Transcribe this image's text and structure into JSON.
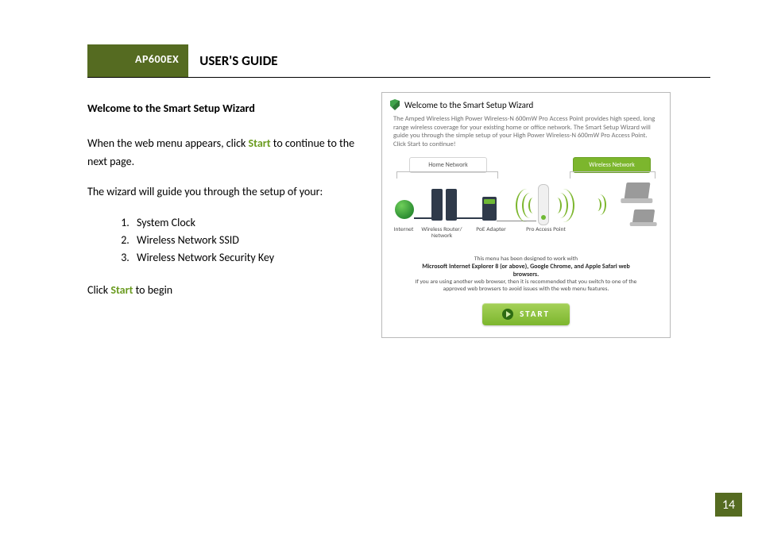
{
  "header": {
    "model": "AP600EX",
    "guide_title": "USER'S GUIDE"
  },
  "left": {
    "subhead": "Welcome to the Smart Setup Wizard",
    "para1_a": "When the web menu appears, click ",
    "para1_start": "Start",
    "para1_b": " to continue to the next page.",
    "para2": "The wizard will guide you through the setup of your:",
    "list": [
      "System Clock",
      "Wireless Network SSID",
      "Wireless Network Security Key"
    ],
    "closing_a": "Click ",
    "closing_start": "Start",
    "closing_b": " to begin"
  },
  "shot": {
    "title": "Welcome to the Smart Setup Wizard",
    "desc": "The Amped Wireless High Power Wireless-N 600mW Pro Access Point provides high speed, long range wireless coverage for your existing home or office network. The Smart Setup Wizard will guide you through the simple setup of your High Power Wireless-N 600mW Pro Access Point. Click Start to continue!",
    "labels": {
      "home_network": "Home Network",
      "wireless_network": "Wireless Network",
      "internet": "Internet",
      "router": "Wireless Router/\nNetwork",
      "poe": "PoE\nAdapter",
      "ap": "Pro Access Point"
    },
    "note_line1": "This menu has been designed to work with",
    "note_line2_bold": "Microsoft Internet Explorer 8 (or above), Google Chrome, and Apple Safari web browsers.",
    "note_line3": "If you are using another web browser, then it is recommended that you switch to one of the approved web browsers to avoid issues with the web menu features.",
    "start_label": "START"
  },
  "page_number": "14"
}
